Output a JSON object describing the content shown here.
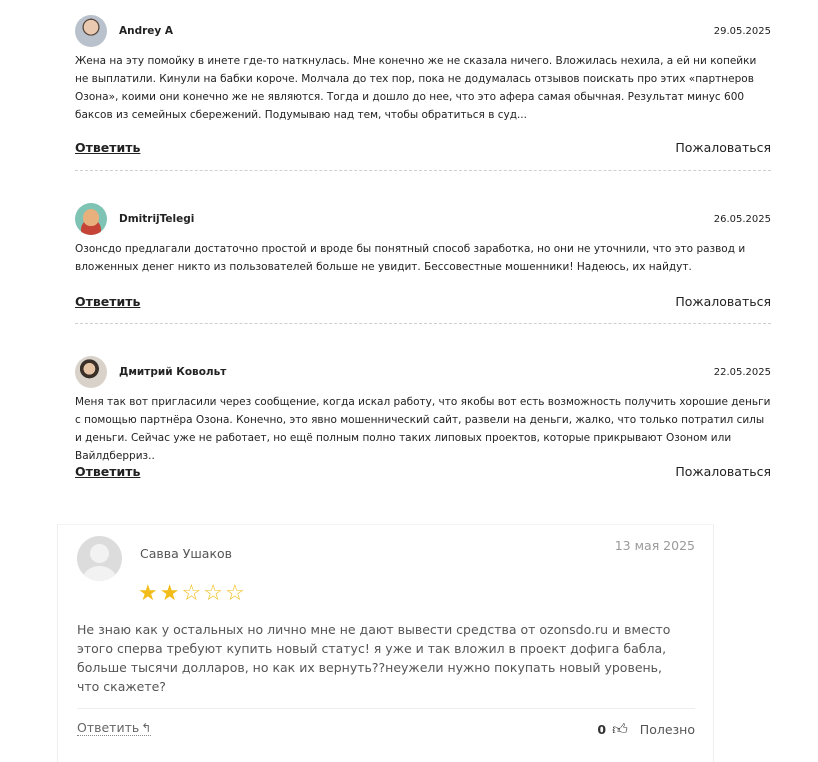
{
  "comments": [
    {
      "author": "Andrey A",
      "date": "29.05.2025",
      "text": "Жена на эту помойку в инете где-то наткнулась. Мне конечно же не сказала ничего. Вложилась нехила, а ей ни копейки не выплатили. Кинули на бабки короче. Молчала до тех пор, пока не додумалась отзывов поискать про этих «партнеров Озона», коими они конечно же не являются. Тогда и дошло до нее, что это афера самая обычная. Результат минус 600 баксов из семейных сбережений. Подумываю над тем, чтобы обратиться в суд...",
      "reply_label": "Ответить",
      "report_label": "Пожаловаться"
    },
    {
      "author": "DmitrijTelegi",
      "date": "26.05.2025",
      "text": "Озонсдо предлагали достаточно простой и вроде бы понятный способ заработка, но они не уточнили, что это развод и вложенных денег никто из пользователей больше не увидит. Бессовестные мошенники! Надеюсь, их найдут.",
      "reply_label": "Ответить",
      "report_label": "Пожаловаться"
    },
    {
      "author": "Дмитрий Ковольт",
      "date": "22.05.2025",
      "text": "Меня так вот пригласили через сообщение, когда искал работу, что якобы вот есть возможность получить хорошие деньги с помощью партнёра Озона. Конечно, это явно мошеннический сайт, развели на деньги, жалко, что только потратил силы и деньги. Сейчас уже не работает, но ещё полным полно таких липовых проектов, которые прикрывают Озоном или Вайлдберриз..",
      "reply_label": "Ответить",
      "report_label": "Пожаловаться"
    }
  ],
  "review": {
    "author": "Савва Ушаков",
    "date": "13 мая 2025",
    "rating": 2,
    "rating_max": 5,
    "text": "Не знаю как у остальных но лично мне не дают вывести средства от ozonsdo.ru и вместо этого сперва требуют купить новый статус! я уже и так вложил в проект дофига бабла, больше тысячи долларов, но как их вернуть??неужели нужно покупать новый уровень, что скажете?",
    "reply_label": "Ответить",
    "useful_count": "0",
    "useful_label": "Полезно",
    "star_color": "#f2bd1a",
    "icons": [
      "reply-arrow-icon",
      "thumbs-up-icon",
      "star-icon"
    ]
  }
}
